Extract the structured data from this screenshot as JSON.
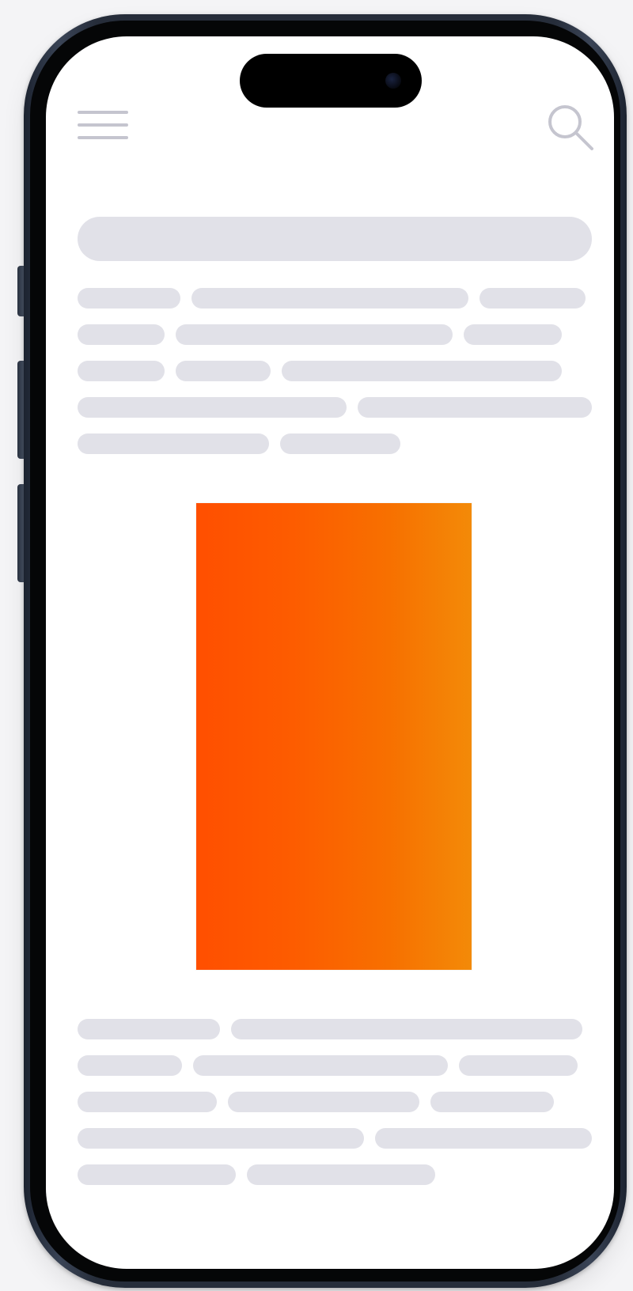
{
  "screen": {
    "header": {
      "menu_icon": "hamburger-menu-icon",
      "search_icon": "search-icon"
    },
    "colors": {
      "skeleton": "#e1e1e8",
      "icon": "#c5c5cf",
      "media_gradient_start": "#ff4f00",
      "media_gradient_end": "#f38a08",
      "phone_frame": "#262d3a",
      "screen_background": "#ffffff"
    },
    "content": {
      "title_placeholder": "",
      "text_placeholder_lines_top": 5,
      "text_placeholder_lines_bottom": 5,
      "media_placeholder": "orange-gradient-image"
    }
  }
}
